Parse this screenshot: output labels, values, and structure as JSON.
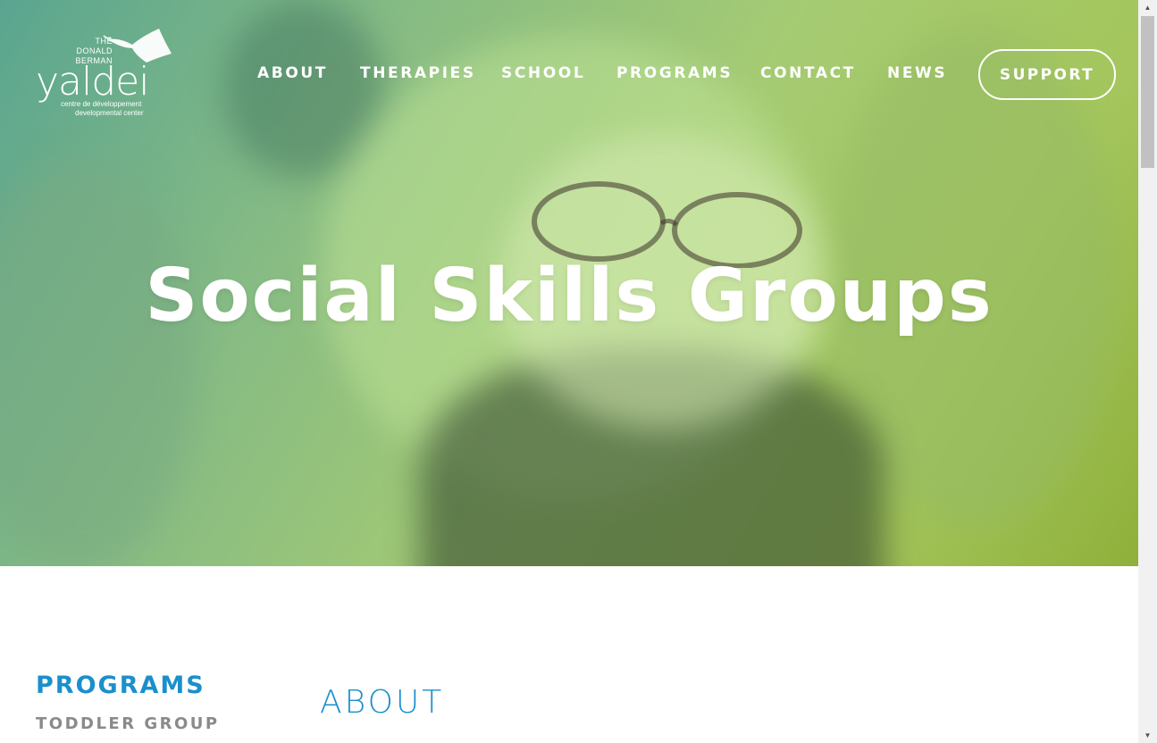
{
  "brand": {
    "logo_the": "THE",
    "logo_donald": "DONALD",
    "logo_berman": "BERMAN",
    "logo_word": "yaldei",
    "logo_tagline_fr": "centre de développement",
    "logo_tagline_en": "developmental center"
  },
  "nav": {
    "items": [
      {
        "label": "ABOUT"
      },
      {
        "label": "THERAPIES"
      },
      {
        "label": "SCHOOL"
      },
      {
        "label": "PROGRAMS"
      },
      {
        "label": "CONTACT"
      },
      {
        "label": "NEWS"
      }
    ],
    "support_label": "SUPPORT"
  },
  "hero": {
    "title": "Social Skills Groups"
  },
  "sidebar": {
    "title": "PROGRAMS",
    "items": [
      {
        "label": "TODDLER GROUP"
      }
    ]
  },
  "main": {
    "heading": "ABOUT"
  },
  "colors": {
    "accent_blue": "#1b8fcc",
    "muted_gray": "#8a8a8a",
    "hero_gradient_start": "#5aa590",
    "hero_gradient_end": "#8fb03a"
  },
  "icons": {
    "scroll_up": "triangle-up-icon",
    "scroll_down": "triangle-down-icon"
  }
}
